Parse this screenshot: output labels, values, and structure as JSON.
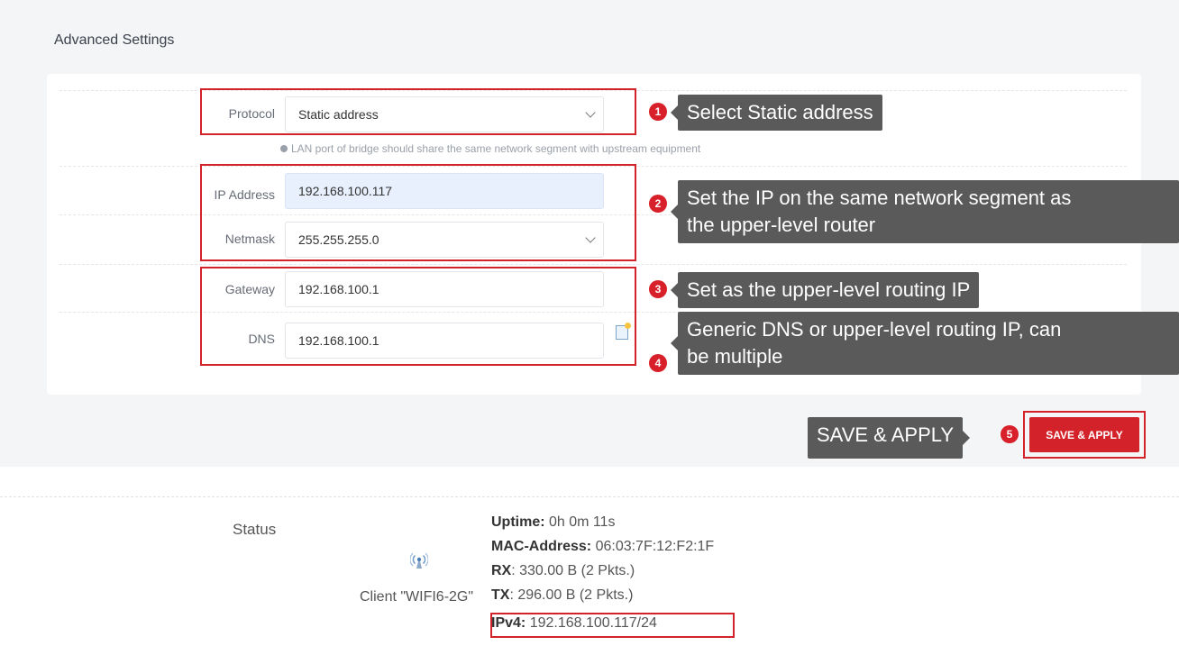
{
  "section": {
    "title": "Advanced Settings"
  },
  "form": {
    "protocol_label": "Protocol",
    "protocol_value": "Static address",
    "hint": "LAN port of bridge should share the same network segment with upstream equipment",
    "ip_label": "IP Address",
    "ip_value": "192.168.100.117",
    "netmask_label": "Netmask",
    "netmask_value": "255.255.255.0",
    "gateway_label": "Gateway",
    "gateway_value": "192.168.100.1",
    "dns_label": "DNS",
    "dns_value": "192.168.100.1"
  },
  "annotations": {
    "step1": {
      "num": "1",
      "text": "Select Static address"
    },
    "step2": {
      "num": "2",
      "line1": "Set the IP on the same network segment as",
      "line2": "the upper-level router"
    },
    "step3": {
      "num": "3",
      "text": "Set as the upper-level routing IP"
    },
    "step4": {
      "num": "4",
      "line1": "Generic DNS or upper-level routing IP, can",
      "line2": "be multiple"
    },
    "step5": {
      "num": "5",
      "text": "SAVE & APPLY"
    }
  },
  "actions": {
    "save_apply": "SAVE & APPLY"
  },
  "status": {
    "label": "Status",
    "client": "Client \"WIFI6-2G\"",
    "uptime_label": "Uptime:",
    "uptime_value": " 0h 0m 11s",
    "mac_label": "MAC-Address:",
    "mac_value": " 06:03:7F:12:F2:1F",
    "rx_label": "RX",
    "rx_value": ": 330.00 B (2 Pkts.)",
    "tx_label": "TX",
    "tx_value": ": 296.00 B (2 Pkts.)",
    "ipv4_label": "IPv4:",
    "ipv4_value": " 192.168.100.117/24"
  },
  "colors": {
    "accent": "#d3222a",
    "callout": "#5a5a5a",
    "autofill": "#e8f0fe"
  },
  "icons": {
    "add": "add-entry-icon",
    "wireless": "wifi-icon",
    "info": "info-icon"
  }
}
